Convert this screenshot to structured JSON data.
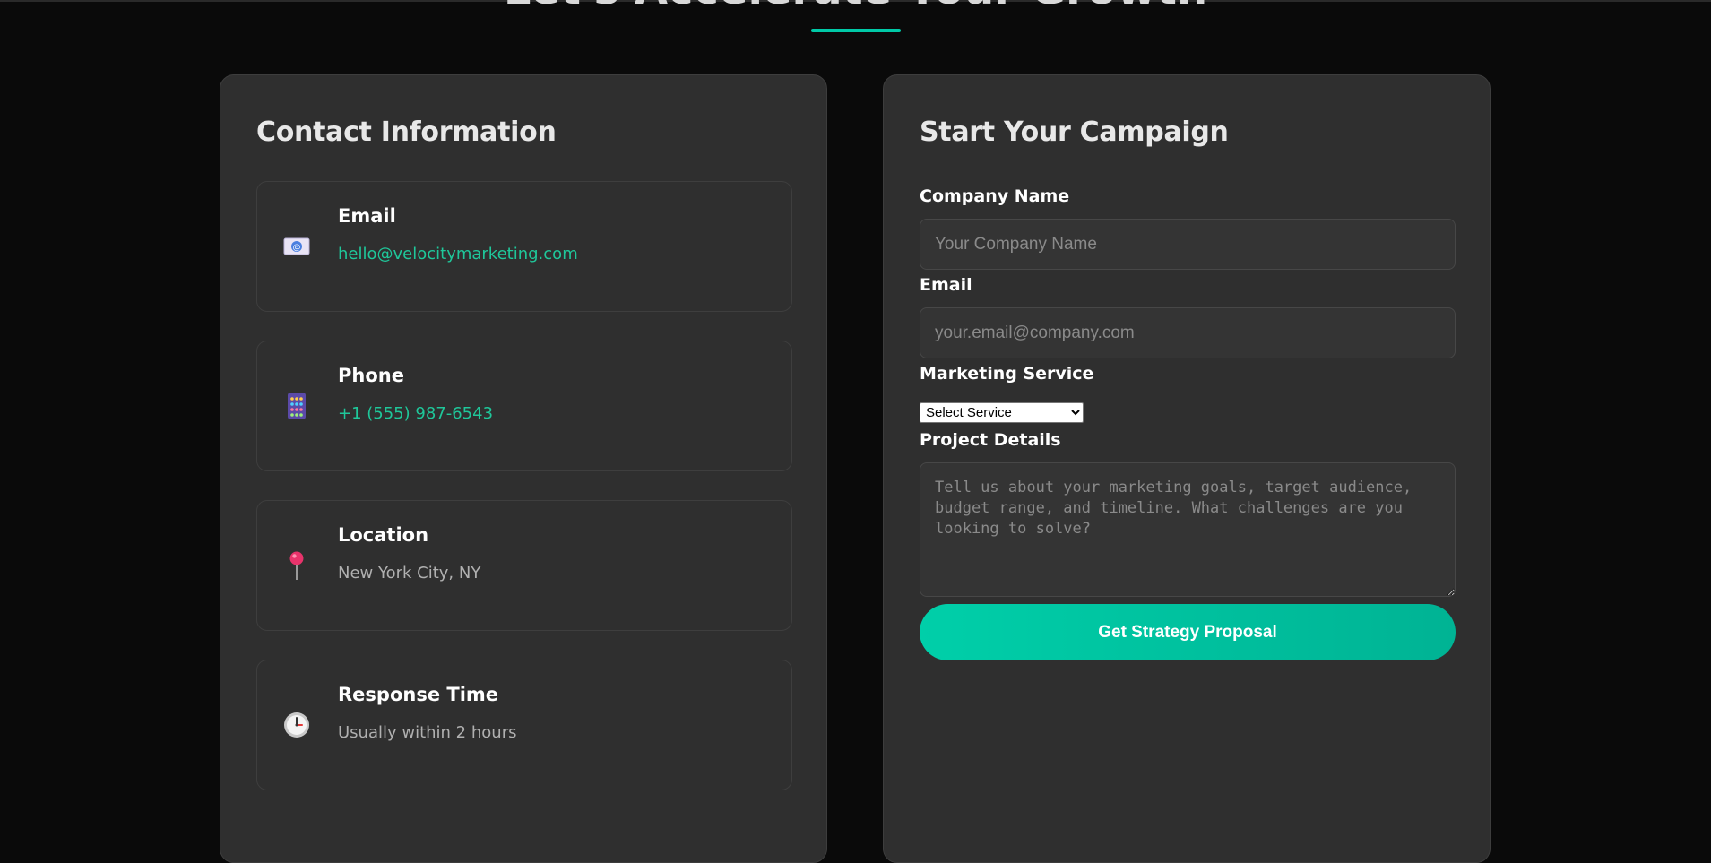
{
  "section": {
    "title": "Let's Accelerate Your Growth"
  },
  "contact": {
    "title": "Contact Information",
    "items": [
      {
        "label": "Email",
        "value": "hello@velocitymarketing.com",
        "icon": "envelope-icon"
      },
      {
        "label": "Phone",
        "value": "+1 (555) 987-6543",
        "icon": "phone-icon"
      },
      {
        "label": "Location",
        "value": "New York City, NY",
        "icon": "pushpin-icon"
      },
      {
        "label": "Response Time",
        "value": "Usually within 2 hours",
        "icon": "clock-icon"
      }
    ]
  },
  "form": {
    "title": "Start Your Campaign",
    "company_label": "Company Name",
    "company_placeholder": "Your Company Name",
    "email_label": "Email",
    "email_placeholder": "your.email@company.com",
    "service_label": "Marketing Service",
    "service_selected": "Select Service",
    "details_label": "Project Details",
    "details_placeholder": "Tell us about your marketing goals, target audience, budget range, and timeline. What challenges are you looking to solve?",
    "submit_label": "Get Strategy Proposal"
  },
  "colors": {
    "accent": "#00c9a7",
    "link": "#1fc79a",
    "card_bg": "#2f2f2f",
    "page_bg": "#0a0a0a"
  }
}
